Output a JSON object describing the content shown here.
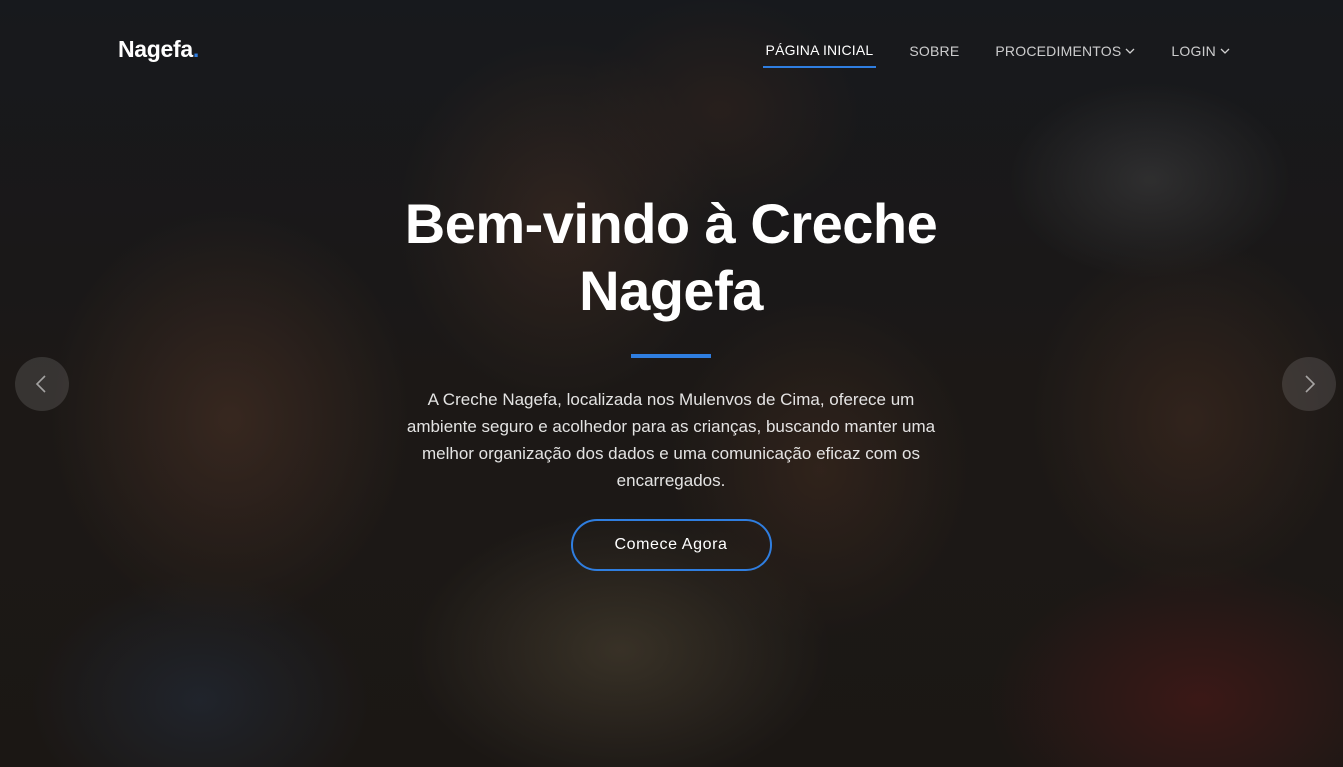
{
  "brand": {
    "name": "Nagefa",
    "dot": ".",
    "accent_color": "#2f7ee0"
  },
  "nav": {
    "items": [
      {
        "label": "PÁGINA INICIAL",
        "active": true,
        "dropdown": false
      },
      {
        "label": "SOBRE",
        "active": false,
        "dropdown": false
      },
      {
        "label": "PROCEDIMENTOS",
        "active": false,
        "dropdown": true
      },
      {
        "label": "LOGIN",
        "active": false,
        "dropdown": true
      }
    ]
  },
  "hero": {
    "title_line1": "Bem-vindo à Creche",
    "title_line2": "Nagefa",
    "description": "A Creche Nagefa, localizada nos Mulenvos de Cima, oferece um ambiente seguro e acolhedor para as crianças, buscando manter uma melhor organização dos dados e uma comunicação eficaz com os encarregados.",
    "cta_label": "Comece Agora"
  },
  "carousel": {
    "prev_icon": "chevron-left-icon",
    "next_icon": "chevron-right-icon"
  }
}
